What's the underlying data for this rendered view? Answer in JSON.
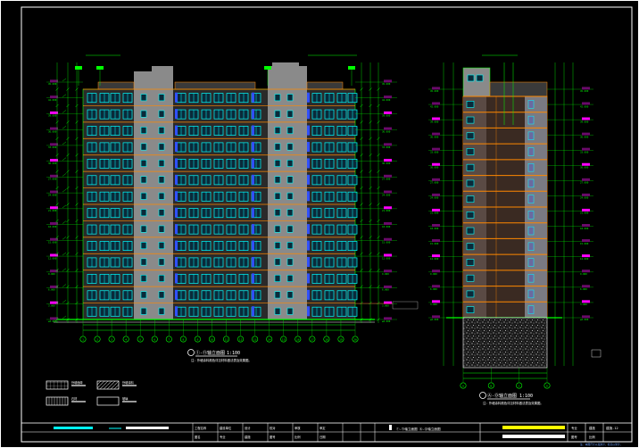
{
  "drawing": {
    "colors": {
      "background": "#000000",
      "frame": "#ffffff",
      "dim": "#00ff00",
      "facade": "#8a8a8a",
      "window": "#00ffff",
      "floor_line": "#ff8800",
      "level_mark": "#ff00ff",
      "title_cyan": "#00ffff",
      "highlight": "#ffff00",
      "hatch": "#d0d0d0",
      "annotation": "#ff4040"
    },
    "front_elevation": {
      "caption": "①-⑪轴立面图",
      "scale": "1:100",
      "note": "注：外墙涂料颜色详见材料做法表及效果图。",
      "floors": 14,
      "axis_labels": [
        "1",
        "2",
        "3",
        "4",
        "5",
        "6",
        "7",
        "8",
        "9",
        "10",
        "11",
        "12",
        "13",
        "14",
        "15",
        "16",
        "17",
        "18",
        "19",
        "20"
      ],
      "roof_tags": [
        "A",
        "B",
        "C",
        "D"
      ]
    },
    "side_elevation": {
      "caption": "Ⓐ-Ⓓ轴立面图",
      "scale": "1:100",
      "note": "注：外墙涂料颜色详见材料做法表及效果图。",
      "floors": 14,
      "axis_labels": [
        "A",
        "B",
        "C",
        "D"
      ]
    },
    "level_marks": [
      "±0.000",
      "3.000",
      "6.000",
      "9.000",
      "12.000",
      "15.000",
      "18.000",
      "21.000",
      "24.000",
      "27.000",
      "30.000",
      "33.000",
      "36.000",
      "39.000",
      "42.000",
      "45.600"
    ],
    "legend": [
      {
        "pattern": "grid",
        "label": "外墙面砖"
      },
      {
        "pattern": "diag",
        "label": "外墙涂料"
      },
      {
        "pattern": "vert",
        "label": "石材"
      },
      {
        "pattern": "blank",
        "label": "玻璃"
      }
    ],
    "title_block": {
      "row1": [
        "工程名称",
        "建设单位",
        "设计",
        "校对",
        "审核",
        "审定"
      ],
      "row2": [
        "图名",
        "专业",
        "建施",
        "图号",
        "比例",
        "日期"
      ],
      "sheet_title": "①-⑪轴立面图 Ⓐ-Ⓓ轴立面图",
      "right_labels": [
        "专业",
        "建施",
        "图号",
        "比例"
      ],
      "sheet_no": "建施-12",
      "footer": "注：本图尺寸以毫米计，标高以米计。"
    }
  }
}
